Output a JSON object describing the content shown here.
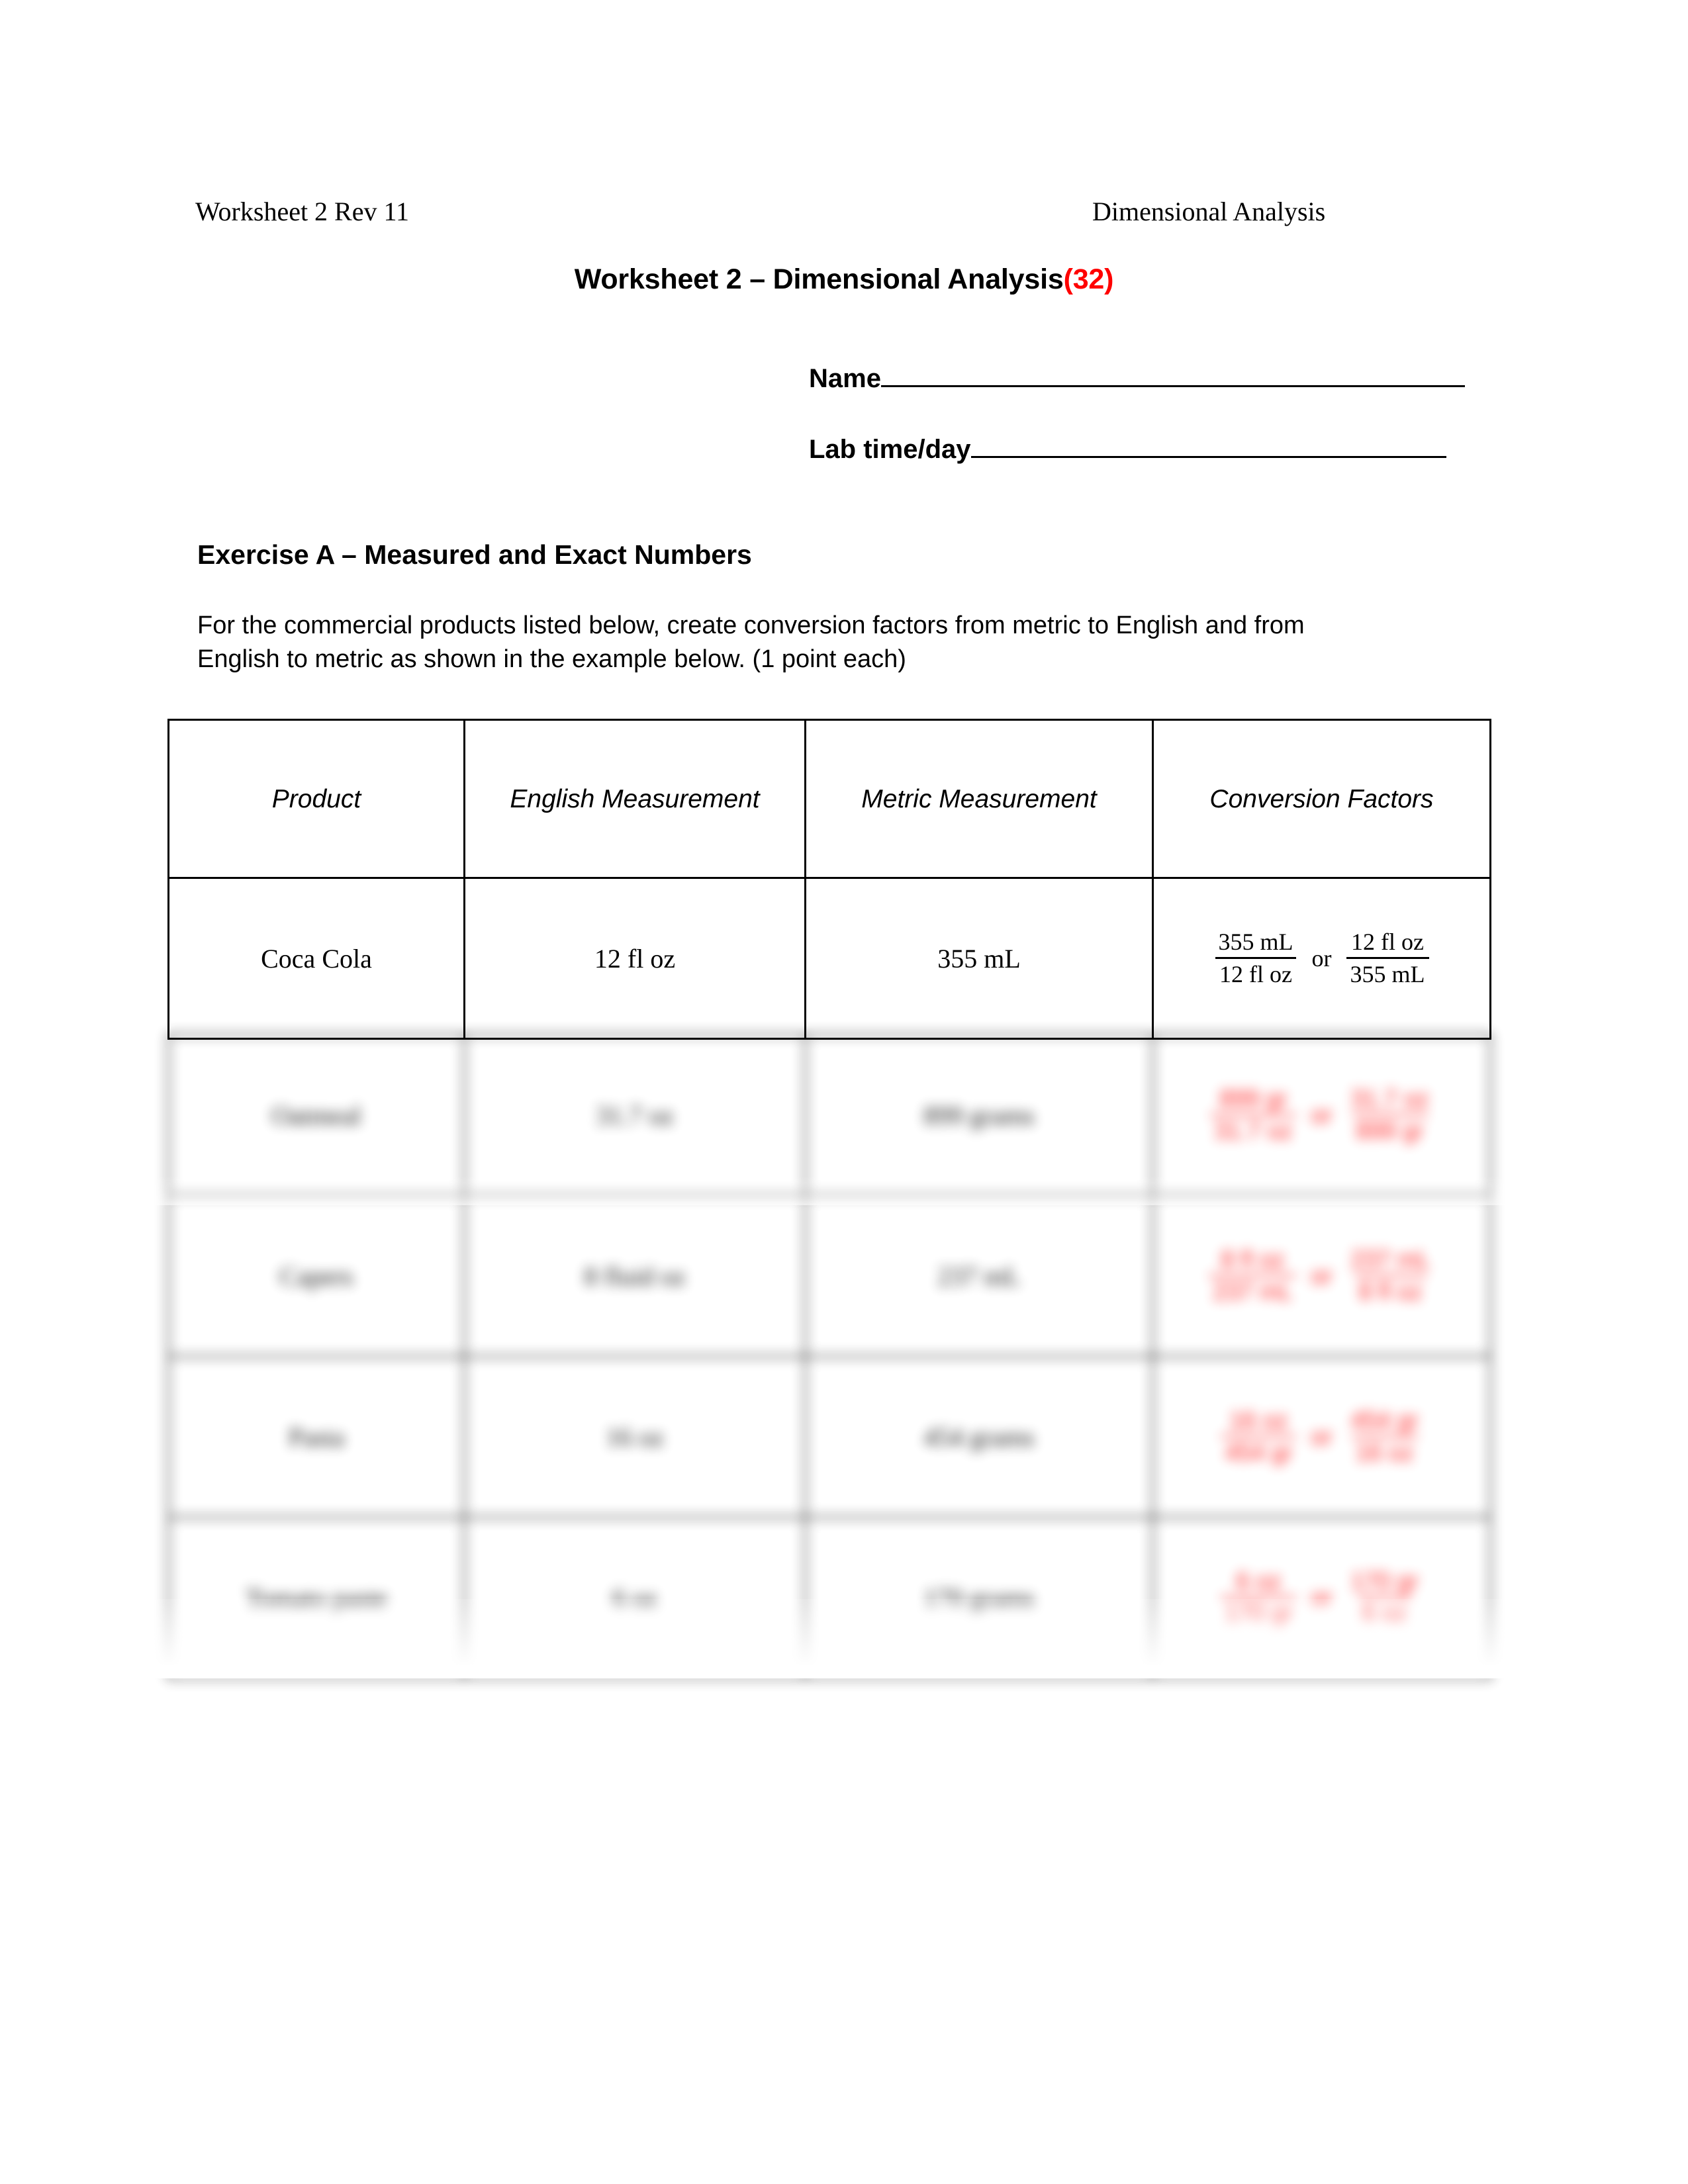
{
  "header": {
    "left": "Worksheet 2 Rev 11",
    "right": "Dimensional Analysis"
  },
  "title": {
    "text": "Worksheet 2 – Dimensional Analysis",
    "points": "(32)",
    "points_color": "#ff0000"
  },
  "fields": [
    {
      "label": "Name"
    },
    {
      "label": "Lab time/day"
    }
  ],
  "exercise": {
    "heading": "Exercise A – Measured and Exact Numbers",
    "instructions": "For the commercial products listed below, create conversion factors from metric to English and from English to metric as shown in the example below. (1 point each)"
  },
  "table": {
    "headers": [
      "Product",
      "English Measurement",
      "Metric Measurement",
      "Conversion Factors"
    ],
    "rows": [
      {
        "product": "Coca Cola",
        "english": "12 fl oz",
        "metric": "355 mL",
        "blurred": false,
        "factors": {
          "left": {
            "num": "355 mL",
            "den": "12 fl oz"
          },
          "or": "or",
          "right": {
            "num": "12 fl oz",
            "den": "355 mL"
          }
        }
      },
      {
        "product": "Oatmeal",
        "english": "31.7 oz",
        "metric": "899 grams",
        "blurred": true,
        "factors": {
          "left": {
            "num": "899 gr",
            "den": "31.7 oz"
          },
          "or": "or",
          "right": {
            "num": "31.7 oz",
            "den": "899 gr"
          }
        }
      },
      {
        "product": "Capers",
        "english": "8 fluid oz",
        "metric": "237 mL",
        "blurred": true,
        "factors": {
          "left": {
            "num": "8 fl oz",
            "den": "237 mL"
          },
          "or": "or",
          "right": {
            "num": "237 mL",
            "den": "8 fl oz"
          }
        }
      },
      {
        "product": "Pasta",
        "english": "16 oz",
        "metric": "454 grams",
        "blurred": true,
        "factors": {
          "left": {
            "num": "16 oz",
            "den": "454 gr"
          },
          "or": "or",
          "right": {
            "num": "454 gr",
            "den": "16 oz"
          }
        }
      },
      {
        "product": "Tomato paste",
        "english": "6 oz",
        "metric": "170 grams",
        "blurred": true,
        "factors": {
          "left": {
            "num": "6 oz",
            "den": "170 gr"
          },
          "or": "or",
          "right": {
            "num": "170 gr",
            "den": "6 oz"
          }
        }
      }
    ]
  }
}
